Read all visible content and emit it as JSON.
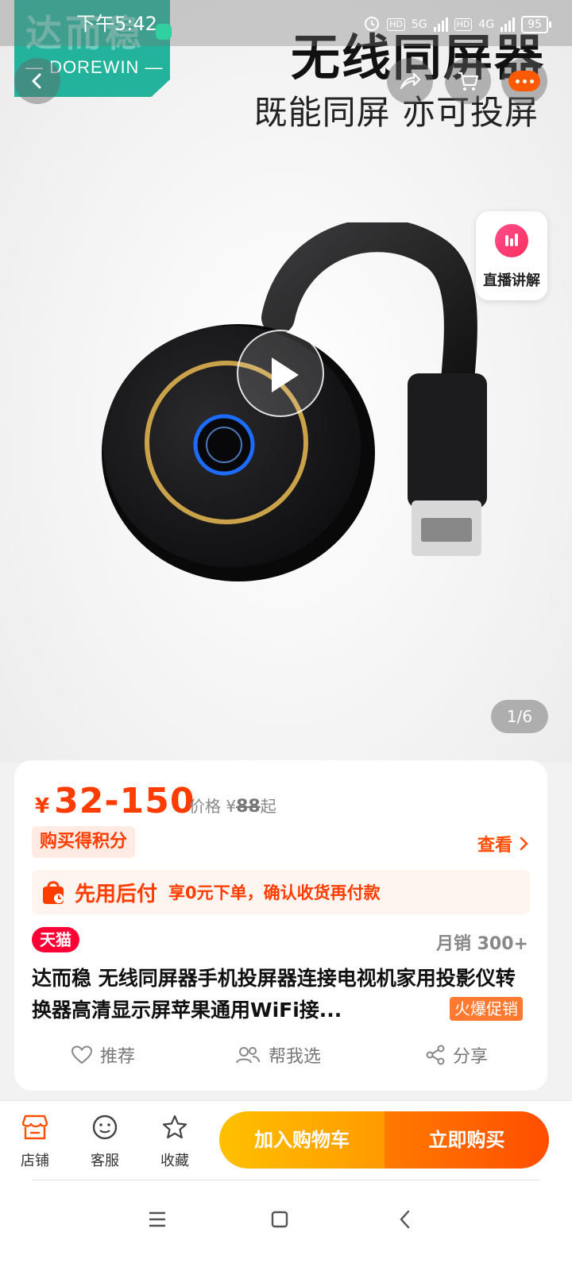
{
  "status_bar": {
    "time": "下午5:42",
    "net1": "5G",
    "net2": "4G",
    "hd": "HD",
    "battery": "95"
  },
  "hero": {
    "brand_cn": "达而稳",
    "brand_en": "— DOREWIN —",
    "title": "无线同屏器",
    "subtitle": "既能同屏 亦可投屏",
    "live_label": "直播讲解",
    "page_indicator": "1/6"
  },
  "product": {
    "currency": "¥",
    "price_range": "32-150",
    "orig_label": "价格 ¥",
    "orig_price": "88",
    "orig_suffix": "起",
    "points_tag": "购买得积分",
    "view_label": "查看",
    "pay_later_title": "先用后付",
    "pay_later_desc": "享0元下单，确认收货再付款",
    "store_badge": "天猫",
    "monthly_sales": "月销 300+",
    "title": "达而稳 无线同屏器手机投屏器连接电视机家用投影仪转换器高清显示屏苹果通用WiFi接...",
    "hot_tag": "火爆促销",
    "actions": {
      "recommend": "推荐",
      "help_choose": "帮我选",
      "share": "分享"
    }
  },
  "bottom_bar": {
    "store": "店铺",
    "service": "客服",
    "favorite": "收藏",
    "add_to_cart": "加入购物车",
    "buy_now": "立即购买"
  },
  "colors": {
    "accent": "#ff4e00",
    "brand_teal": "#23b29b",
    "tmall_red": "#ff0036"
  }
}
